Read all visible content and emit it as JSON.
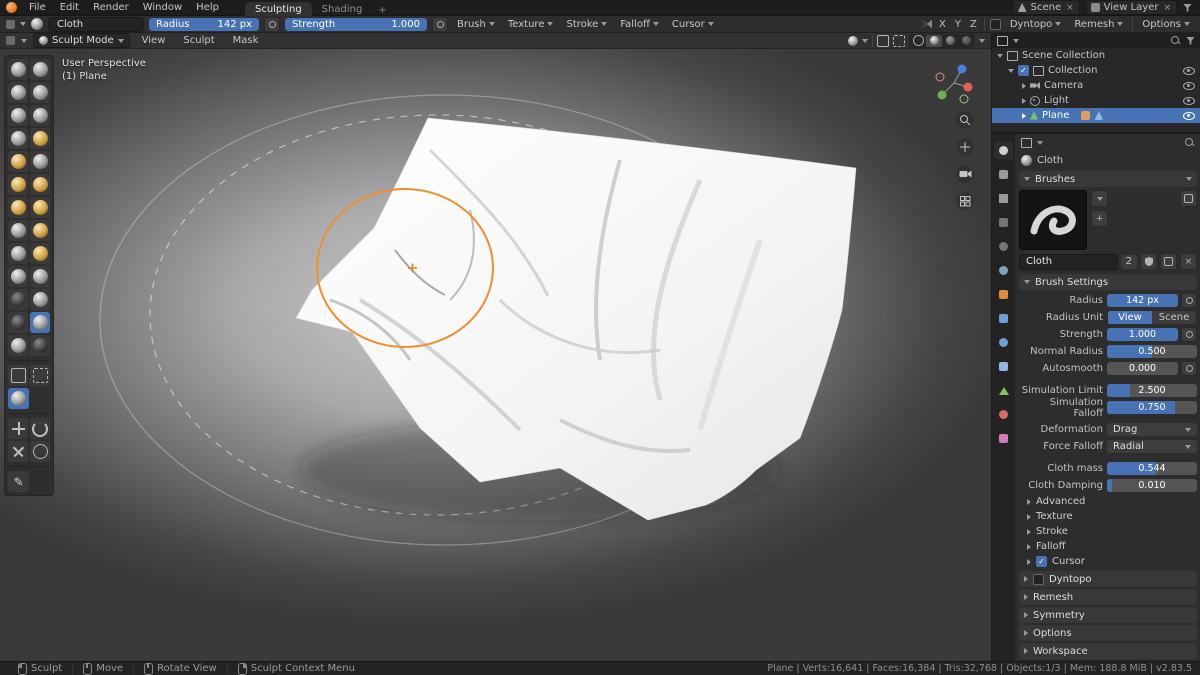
{
  "icons": {
    "close": "×",
    "add": "+",
    "check": "✓",
    "annotate": "✎"
  },
  "topbar": {
    "menus": [
      {
        "label": "File"
      },
      {
        "label": "Edit"
      },
      {
        "label": "Render"
      },
      {
        "label": "Window"
      },
      {
        "label": "Help"
      }
    ],
    "tabs": [
      {
        "label": "Sculpting"
      },
      {
        "label": "Shading"
      }
    ],
    "scene": {
      "label": "Scene"
    },
    "view_layer": {
      "label": "View Layer"
    }
  },
  "tool_settings": {
    "brush_name": "Cloth",
    "radius": {
      "label": "Radius",
      "value": "142 px",
      "fill": 1
    },
    "strength": {
      "label": "Strength",
      "value": "1.000",
      "fill": 1
    },
    "menus": [
      {
        "label": "Brush"
      },
      {
        "label": "Texture"
      },
      {
        "label": "Stroke"
      },
      {
        "label": "Falloff"
      },
      {
        "label": "Cursor"
      }
    ],
    "symmetry": {
      "x": "X",
      "y": "Y",
      "z": "Z"
    },
    "right_menus": [
      {
        "label": "Dyntopo"
      },
      {
        "label": "Remesh"
      },
      {
        "label": "Options"
      }
    ]
  },
  "viewport_header": {
    "mode": "Sculpt Mode",
    "menus": [
      {
        "label": "View"
      },
      {
        "label": "Sculpt"
      },
      {
        "label": "Mask"
      }
    ]
  },
  "viewport": {
    "perspective": "User Perspective",
    "object": "(1) Plane",
    "brush_color": "#ef8f2d"
  },
  "outliner": {
    "root": "Scene Collection",
    "items": [
      {
        "label": "Collection"
      },
      {
        "label": "Camera"
      },
      {
        "label": "Light"
      },
      {
        "label": "Plane"
      }
    ]
  },
  "properties": {
    "breadcrumb": "Cloth",
    "brushes": {
      "header": "Brushes",
      "name": "Cloth",
      "count": "2"
    },
    "settings_header": "Brush Settings",
    "fields": [
      {
        "label": "Radius",
        "value": "142 px",
        "fill": 1
      },
      {
        "label": "Radius Unit",
        "view": "View",
        "scene": "Scene"
      },
      {
        "label": "Strength",
        "value": "1.000",
        "fill": 1
      },
      {
        "label": "Normal Radius",
        "value": "0.500",
        "fill": 0.5
      },
      {
        "label": "Autosmooth",
        "value": "0.000",
        "fill": 0
      },
      {
        "label": "Simulation Limit",
        "value": "2.500",
        "fill": 0.25
      },
      {
        "label": "Simulation Falloff",
        "value": "0.750",
        "fill": 0.75
      },
      {
        "label": "Deformation",
        "value": "Drag"
      },
      {
        "label": "Force Falloff",
        "value": "Radial"
      },
      {
        "label": "Cloth mass",
        "value": "0.544",
        "fill": 0.54
      },
      {
        "label": "Cloth Damping",
        "value": "0.010",
        "fill": 0.05
      }
    ],
    "sub_sections": [
      {
        "label": "Advanced"
      },
      {
        "label": "Texture"
      },
      {
        "label": "Stroke"
      },
      {
        "label": "Falloff"
      },
      {
        "label": "Cursor"
      }
    ],
    "panels": [
      {
        "label": "Dyntopo"
      },
      {
        "label": "Remesh"
      },
      {
        "label": "Symmetry"
      },
      {
        "label": "Options"
      },
      {
        "label": "Workspace"
      }
    ]
  },
  "statusbar": {
    "hints": [
      {
        "label": "Sculpt"
      },
      {
        "label": "Move"
      },
      {
        "label": "Rotate View"
      },
      {
        "label": "Sculpt Context Menu"
      }
    ],
    "stats": "Plane | Verts:16,641 | Faces:16,384 | Tris:32,768 | Objects:1/3 | Mem: 188.8 MiB | v2.83.5"
  }
}
